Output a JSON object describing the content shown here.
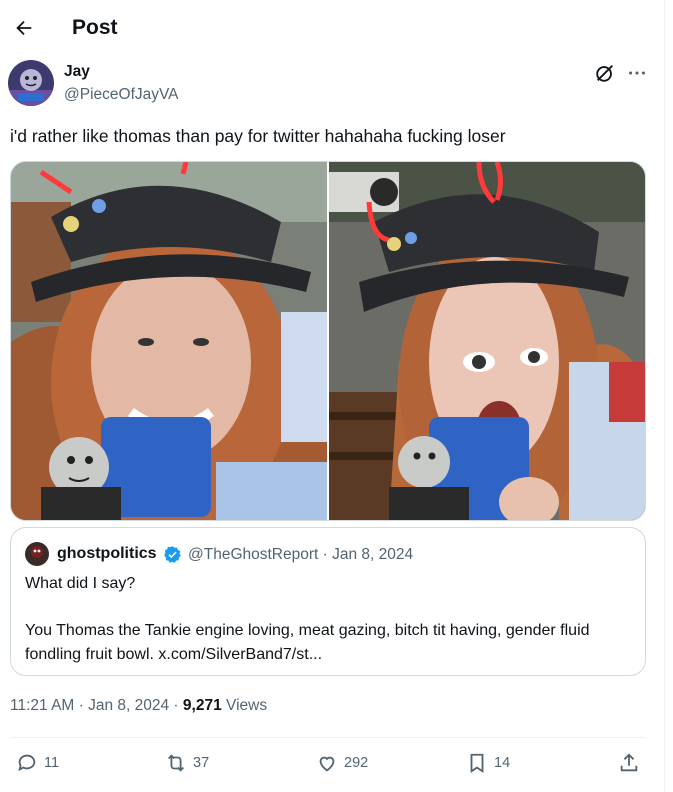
{
  "header": {
    "title": "Post"
  },
  "author": {
    "name": "Jay",
    "handle": "@PieceOfJayVA"
  },
  "tweet": {
    "text": "i'd rather like thomas than pay for twitter hahahaha fucking loser"
  },
  "quote": {
    "name": "ghostpolitics",
    "meta": "@TheGhostReport · Jan 8, 2024",
    "line1": "What did I say?",
    "body": "You Thomas the Tankie engine loving, meat gazing, bitch tit having, gender fluid fondling fruit bowl. x.com/SilverBand7/st..."
  },
  "timestamp": {
    "time_date": "11:21 AM · Jan 8, 2024 · ",
    "views_count": "9,271",
    "views_label": " Views"
  },
  "actions": {
    "replies": "11",
    "reposts": "37",
    "likes": "292",
    "bookmarks": "14"
  },
  "colors": {
    "text": "#0f1419",
    "secondary": "#536471",
    "border": "#cfd9de",
    "verified": "#1d9bf0"
  }
}
